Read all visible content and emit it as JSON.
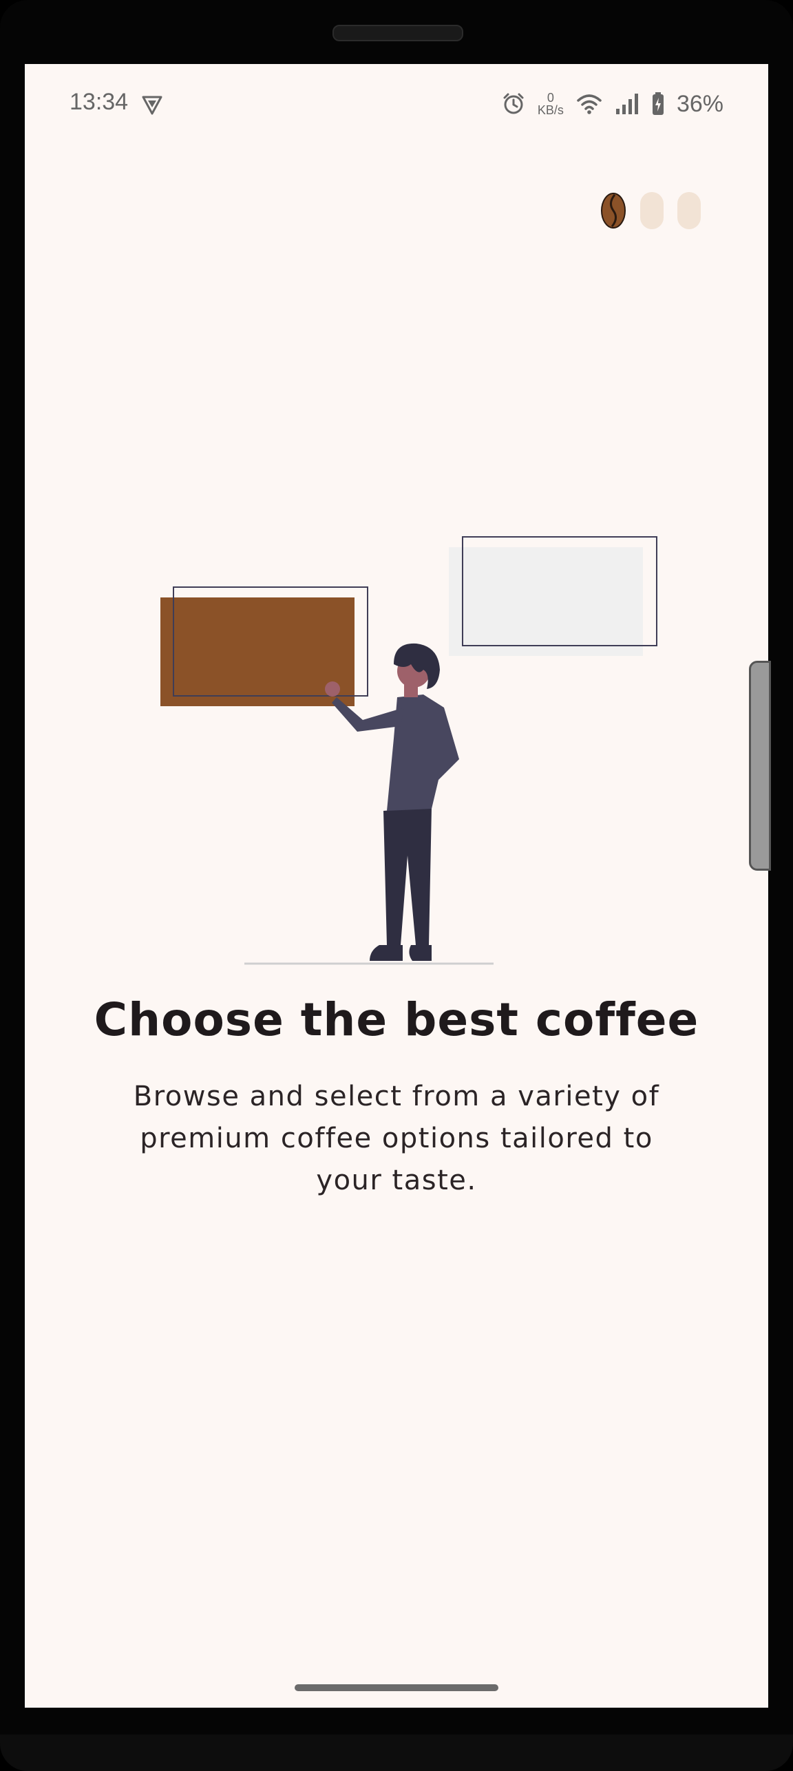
{
  "status_bar": {
    "time": "13:34",
    "net_speed_value": "0",
    "net_speed_unit": "KB/s",
    "battery_percent": "36%",
    "icons": [
      "vpn-icon",
      "alarm-icon",
      "wifi-icon",
      "signal-icon",
      "battery-icon"
    ]
  },
  "onboarding": {
    "page_indicator": {
      "total": 3,
      "active_index": 0,
      "active_icon": "coffee-bean-icon"
    },
    "title": "Choose the best coffee",
    "description": "Browse and select from a variety of premium coffee options tailored to your taste."
  },
  "colors": {
    "background": "#fdf7f4",
    "accent_brown": "#8b5228",
    "inactive_dot": "#f2e3d5",
    "figure_dark": "#3f3d56",
    "title_text": "#1f1a1c"
  }
}
